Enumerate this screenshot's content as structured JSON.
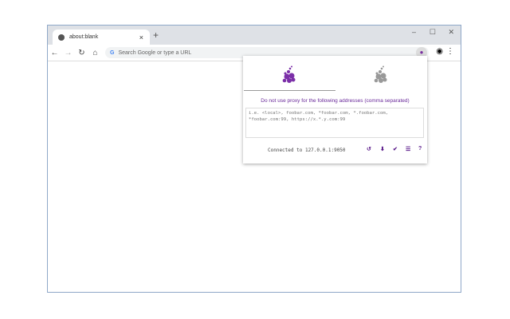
{
  "tab": {
    "title": "about:blank",
    "close": "×",
    "new": "+"
  },
  "window": {
    "minimize": "–",
    "maximize": "☐",
    "close": "✕"
  },
  "nav": {
    "back": "←",
    "forward": "→",
    "reload": "↻",
    "home": "⌂"
  },
  "omnibox": {
    "placeholder": "Search Google or type a URL",
    "g": "G"
  },
  "popup": {
    "note": "Do not use proxy for the following addresses (comma separated)",
    "placeholder": "i.e. <local>, foobar.com, *foobar.com, *.foobar.com, *foobar.com:99, https://x.*.y.com:99",
    "status": "Connected to 127.0.0.1:9050",
    "icons": {
      "reload": "↺",
      "download": "⬇",
      "check": "✔",
      "list": "☰",
      "help": "?"
    },
    "accent": "#7b2fa8"
  }
}
